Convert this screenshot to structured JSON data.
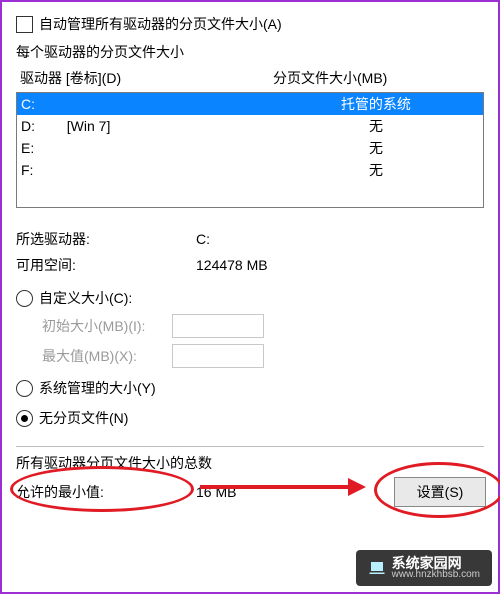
{
  "auto_manage_label": "自动管理所有驱动器的分页文件大小(A)",
  "per_drive_label": "每个驱动器的分页文件大小",
  "col_drive": "驱动器 [卷标](D)",
  "col_size": "分页文件大小(MB)",
  "drives": [
    {
      "letter": "C:",
      "vol": "",
      "size": "托管的系统",
      "selected": true
    },
    {
      "letter": "D:",
      "vol": "[Win 7]",
      "size": "无",
      "selected": false
    },
    {
      "letter": "E:",
      "vol": "",
      "size": "无",
      "selected": false
    },
    {
      "letter": "F:",
      "vol": "",
      "size": "无",
      "selected": false
    }
  ],
  "selected_drive_label": "所选驱动器:",
  "selected_drive_value": "C:",
  "free_space_label": "可用空间:",
  "free_space_value": "124478 MB",
  "opt_custom": "自定义大小(C):",
  "initial_label": "初始大小(MB)(I):",
  "max_label": "最大值(MB)(X):",
  "opt_system": "系统管理的大小(Y)",
  "opt_none": "无分页文件(N)",
  "set_button": "设置(S)",
  "totals_label": "所有驱动器分页文件大小的总数",
  "min_allowed_label": "允许的最小值:",
  "min_allowed_value": "16 MB",
  "watermark_text": "系统家园网",
  "watermark_url": "www.hnzkhbsb.com",
  "annot_color": "#e01b24"
}
